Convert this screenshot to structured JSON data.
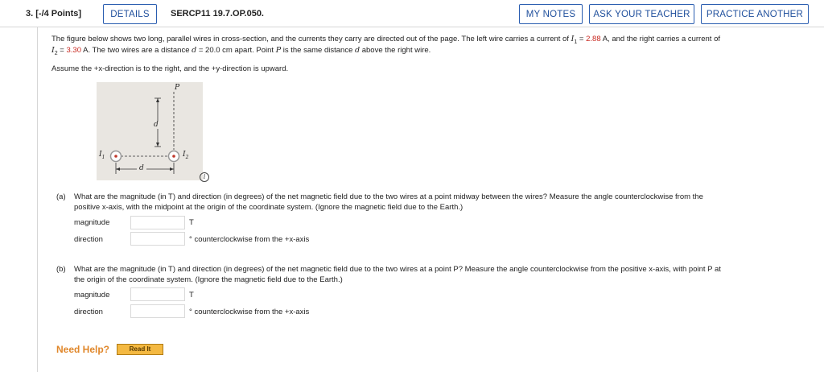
{
  "header": {
    "question_number": "3.",
    "points": "[-/4 Points]",
    "details_label": "DETAILS",
    "problem_code": "SERCP11 19.7.OP.050.",
    "my_notes_label": "MY NOTES",
    "ask_teacher_label": "ASK YOUR TEACHER",
    "practice_label": "PRACTICE ANOTHER"
  },
  "problem": {
    "line1_a": "The figure below shows two long, parallel wires in cross-section, and the currents they carry are directed out of the page. The left wire carries a current of ",
    "i1_symbol": "I",
    "i1_sub": "1",
    "eq": " = ",
    "i1_value": "2.88",
    "line1_b": " A, and the right carries a current of",
    "i2_symbol": "I",
    "i2_sub": "2",
    "i2_value": "3.30",
    "line2_b": " A. The two wires are a distance ",
    "d_symbol": "d",
    "line2_c": " = 20.0 cm apart. Point ",
    "p_symbol": "P",
    "line2_d": " is the same distance ",
    "line2_e": " above the right wire.",
    "assume": "Assume the +x-direction is to the right, and the +y-direction is upward."
  },
  "figure": {
    "label_p": "P",
    "label_d_vertical": "d",
    "label_d_horizontal": "d",
    "label_i1": "I",
    "label_i1_sub": "1",
    "label_i2": "I",
    "label_i2_sub": "2",
    "info_icon_glyph": "i"
  },
  "part_a": {
    "letter": "(a)",
    "line1": "What are the magnitude (in T) and direction (in degrees) of the net magnetic field due to the two wires at a point midway between the wires? Measure the angle counterclockwise from the",
    "line2": "positive x-axis, with the midpoint at the origin of the coordinate system. (Ignore the magnetic field due to the Earth.)",
    "magnitude_label": "magnitude",
    "magnitude_value": "",
    "magnitude_unit": "T",
    "direction_label": "direction",
    "direction_value": "",
    "direction_unit": "° counterclockwise from the +x-axis"
  },
  "part_b": {
    "letter": "(b)",
    "line1": "What are the magnitude (in T) and direction (in degrees) of the net magnetic field due to the two wires at a point P? Measure the angle counterclockwise from the positive x-axis, with point P at",
    "line2": "the origin of the coordinate system. (Ignore the magnetic field due to the Earth.)",
    "magnitude_label": "magnitude",
    "magnitude_value": "",
    "magnitude_unit": "T",
    "direction_label": "direction",
    "direction_value": "",
    "direction_unit": "° counterclockwise from the +x-axis"
  },
  "help": {
    "need_help_label": "Need Help?",
    "read_it_label": "Read It"
  }
}
